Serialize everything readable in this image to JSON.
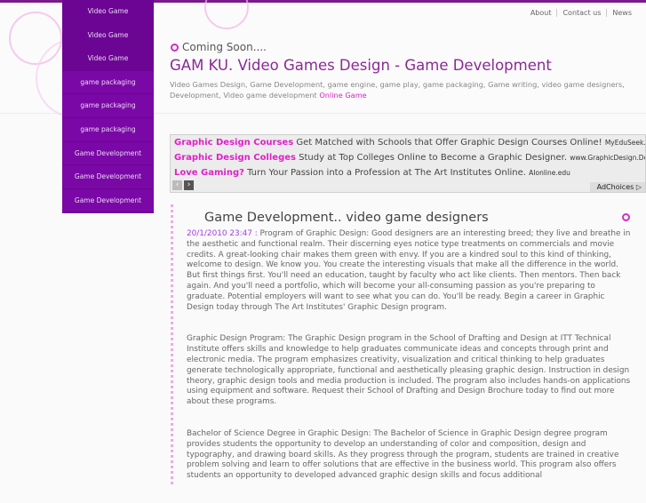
{
  "top_links": [
    "About",
    "Contact us",
    "News"
  ],
  "nav": [
    "Video Game",
    "Video Game",
    "Video Game",
    "game packaging",
    "game packaging",
    "game packaging",
    "Game Development",
    "Game Development",
    "Game Development"
  ],
  "header": {
    "coming": "Coming Soon....",
    "title": "GAM KU. Video Games Design - Game Development",
    "tags": "Video Games Design, Game Development, game engine, game play, game packaging, Game writing, video game designers, Development, Video game development",
    "tags_link": "Online Game"
  },
  "ads": [
    {
      "title": "Graphic Design Courses",
      "text": "Get Matched with Schools that Offer Graphic Design Courses Online!",
      "url": "MyEduSeek.com/..."
    },
    {
      "title": "Graphic Design Colleges",
      "text": "Study at Top Colleges Online to Become a Graphic Designer.",
      "url": "www.GraphicDesign.Degree..."
    },
    {
      "title": "Love Gaming?",
      "text": "Turn Your Passion into a Profession at The Art Institutes Online.",
      "url": "AIonline.edu"
    }
  ],
  "adchoices": "AdChoices",
  "post": {
    "title": "Game Development.. video game designers",
    "date": "20/1/2010 23:47 :",
    "p1": "Program of Graphic Design: Good designers are an interesting breed; they live and breathe in the aesthetic and functional realm. Their discerning eyes notice type treatments on commercials and movie credits. A great-looking chair makes them green with envy. If you are a kindred soul to this kind of thinking, welcome to design. We know you. You create the interesting visuals that make all the difference in the world. But first things first. You'll need an education, taught by faculty who act like clients. Then mentors. Then back again. And you'll need a portfolio, which will become your all-consuming passion as you're preparing to graduate. Potential employers will want to see what you can do. You'll be ready. Begin a career in Graphic Design today through The Art Institutes' Graphic Design program.",
    "p2": "Graphic Design Program: The Graphic Design program in the School of Drafting and Design at ITT Technical Institute offers skills and knowledge to help graduates communicate ideas and concepts through print and electronic media. The program emphasizes creativity, visualization and critical thinking to help graduates generate technologically appropriate, functional and aesthetically pleasing graphic design. Instruction in design theory, graphic design tools and media production is included. The program also includes hands-on applications using equipment and software. Request their School of Drafting and Design Brochure today to find out more about these programs.",
    "p3": "Bachelor of Science Degree in Graphic Design: The Bachelor of Science in Graphic Design degree program provides students the opportunity to develop an understanding of color and composition, design and typography, and drawing board skills. As they progress through the program, students are trained in creative problem solving and learn to offer solutions that are effective in the business world. This program also offers students an opportunity to developed advanced graphic design skills and focus additional"
  }
}
